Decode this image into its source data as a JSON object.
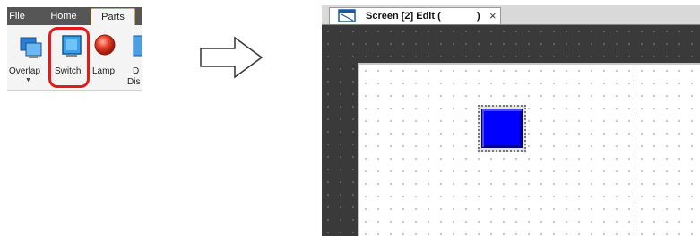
{
  "ribbon": {
    "tabs": [
      {
        "label": "File"
      },
      {
        "label": "Home"
      },
      {
        "label": "Parts",
        "active": true
      }
    ],
    "buttons": [
      {
        "label": "Overlap",
        "icon": "overlap-icon"
      },
      {
        "label": "Switch",
        "icon": "switch-icon",
        "highlighted": true
      },
      {
        "label": "Lamp",
        "icon": "lamp-icon"
      },
      {
        "label": "D",
        "label_line2": "Dis",
        "icon": "data-display-icon"
      }
    ]
  },
  "editor": {
    "tab": {
      "title": "Screen [2] Edit (",
      "title_suffix": ")",
      "close_glyph": "×"
    }
  },
  "colors": {
    "highlight": "#e31b1b",
    "switch_fill": "#0000ff",
    "workspace": "#3a3a3a",
    "ribbon_tabs": "#565656"
  }
}
